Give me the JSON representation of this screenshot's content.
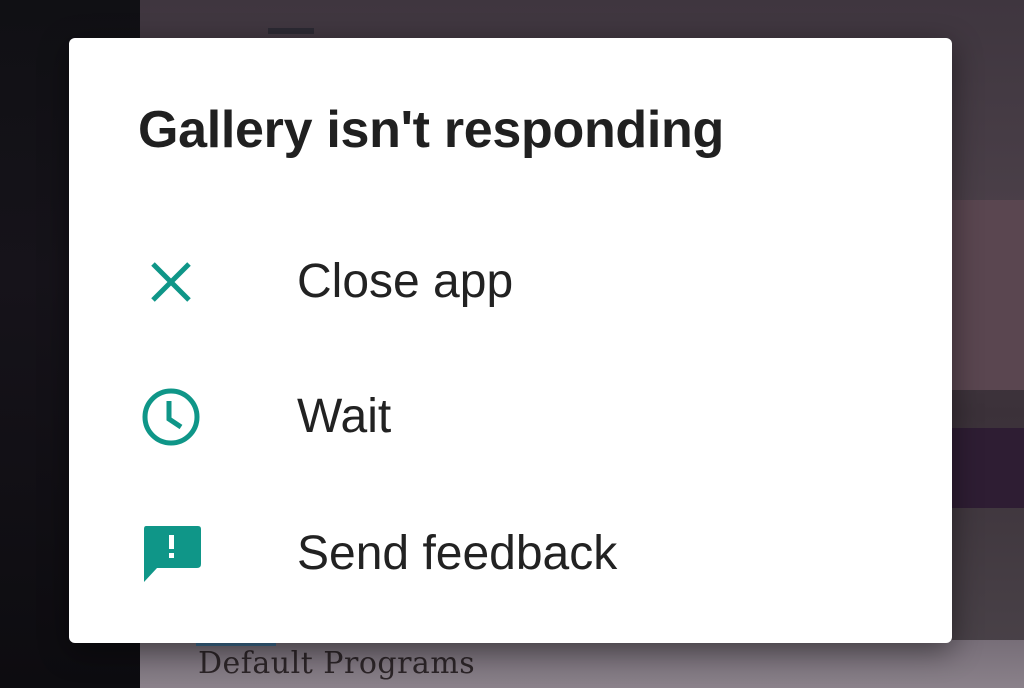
{
  "background": {
    "text": "Default Programs"
  },
  "dialog": {
    "title": "Gallery isn't responding",
    "accent_color": "#0f9688",
    "options": [
      {
        "label": "Close app",
        "icon": "close-icon"
      },
      {
        "label": "Wait",
        "icon": "clock-icon"
      },
      {
        "label": "Send feedback",
        "icon": "feedback-icon"
      }
    ]
  }
}
